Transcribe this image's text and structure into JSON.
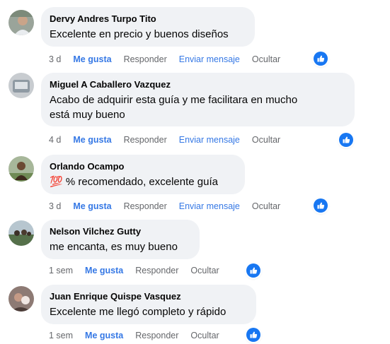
{
  "comments": [
    {
      "author": "Dervy Andres Turpo Tito",
      "text_lines": [
        "Excelente en precio y buenos diseños"
      ],
      "time": "3 d",
      "like": "Me gusta",
      "reply": "Responder",
      "send": "Enviar mensaje",
      "hide": "Ocultar",
      "reactions": "like-icon"
    },
    {
      "author": "Miguel A Caballero Vazquez",
      "text_lines": [
        "Acabo de adquirir esta guía y me facilitara en mucho",
        "está muy bueno"
      ],
      "time": "4 d",
      "like": "Me gusta",
      "reply": "Responder",
      "send": "Enviar mensaje",
      "hide": "Ocultar",
      "reactions": "like-icon"
    },
    {
      "author": "Orlando Ocampo",
      "text_lines": [
        "💯 % recomendado, excelente guía"
      ],
      "time": "3 d",
      "like": "Me gusta",
      "reply": "Responder",
      "send": "Enviar mensaje",
      "hide": "Ocultar",
      "reactions": "like-icon"
    },
    {
      "author": "Nelson Vilchez Gutty",
      "text_lines": [
        "me encanta, es muy bueno"
      ],
      "time": "1 sem",
      "like": "Me gusta",
      "reply": "Responder",
      "hide": "Ocultar",
      "reactions": "like-icon"
    },
    {
      "author": "Juan Enrique Quispe Vasquez",
      "text_lines": [
        "Excelente me llegó completo y rápido"
      ],
      "time": "1 sem",
      "like": "Me gusta",
      "reply": "Responder",
      "hide": "Ocultar",
      "reactions": "like-icon"
    }
  ],
  "colors": {
    "bubble_bg": "#f0f2f5",
    "link_blue": "#3578e5",
    "muted_gray": "#65676b",
    "reaction_blue": "#1877f2"
  }
}
